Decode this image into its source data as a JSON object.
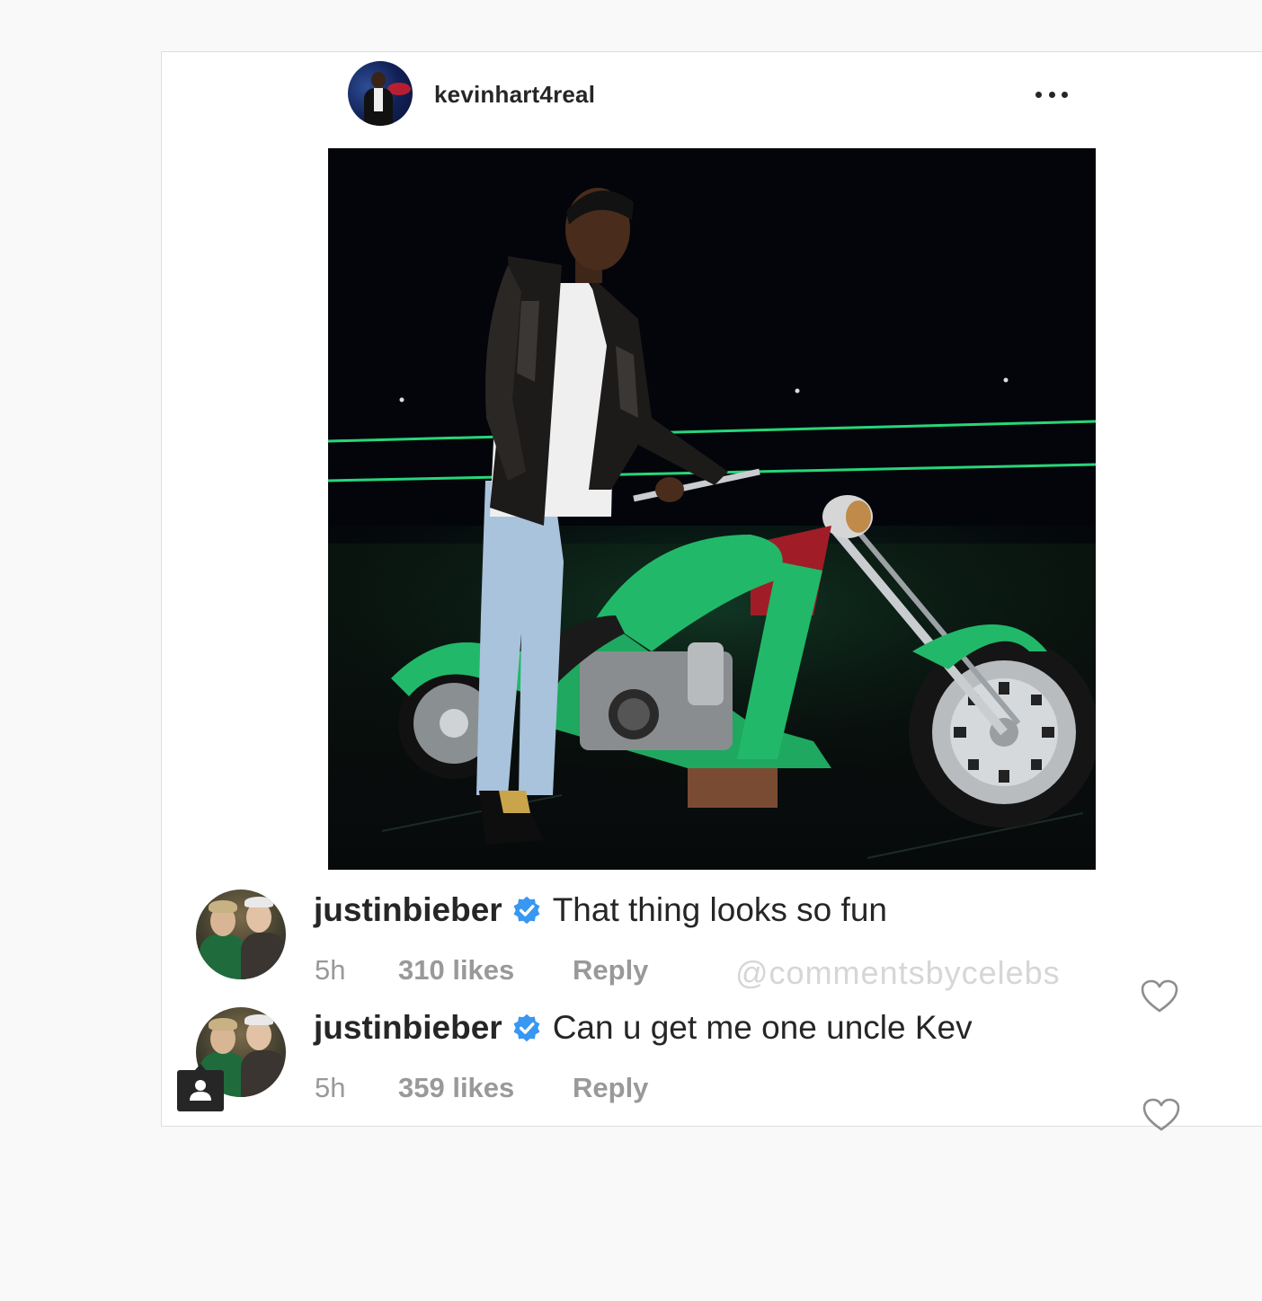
{
  "post": {
    "author": "kevinhart4real",
    "more_icon": "more-horizontal-icon"
  },
  "comments": [
    {
      "username": "justinbieber",
      "verified": true,
      "text": "That thing looks so fun",
      "time": "5h",
      "likes": "310 likes",
      "reply_label": "Reply",
      "watermark": "@commentsbycelebs"
    },
    {
      "username": "justinbieber",
      "verified": true,
      "text": "Can u get me one uncle Kev",
      "time": "5h",
      "likes": "359 likes",
      "reply_label": "Reply"
    }
  ],
  "colors": {
    "verified_blue": "#3897f0",
    "text_primary": "#262626",
    "text_secondary": "#999999",
    "bike_green": "#22b86a",
    "stage_line": "#27d67a"
  }
}
